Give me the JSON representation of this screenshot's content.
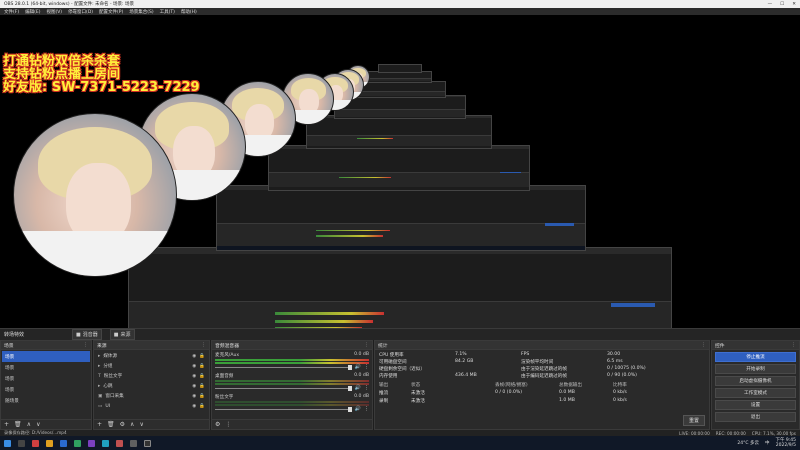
{
  "window": {
    "title": "OBS 28.0.1 (64-bit, windows) - 配置文件: 未命名 - 场景: 场景",
    "controls": [
      "—",
      "☐",
      "✕"
    ]
  },
  "menu": [
    "文件(F)",
    "编辑(E)",
    "视图(V)",
    "停靠窗口(D)",
    "配置文件(P)",
    "场景集合(S)",
    "工具(T)",
    "帮助(H)"
  ],
  "preview": {
    "overlay_lines": [
      "打通钻粉双倍杀杀套",
      "支持钻粉点播上房间",
      "好友版: SW-7371-5223-7229"
    ]
  },
  "dock_tabs": {
    "left_label": "转场特效",
    "tab1": "混音器",
    "tab2": "来源"
  },
  "scenes": {
    "title": "场景",
    "items": [
      "场景",
      "场景",
      "场景",
      "场景",
      "场景",
      "随场景"
    ],
    "selected_index": 0,
    "footer": [
      "+",
      "🗑",
      "∧",
      "∨"
    ]
  },
  "sources": {
    "title": "来源",
    "items": [
      {
        "icon": "▸",
        "name": "媒体源"
      },
      {
        "icon": "▸",
        "name": "分组"
      },
      {
        "icon": "T",
        "name": "粉丝文字"
      },
      {
        "icon": "▸",
        "name": "心跳"
      },
      {
        "icon": "▣",
        "name": "窗口采集"
      },
      {
        "icon": "▭",
        "name": "UI"
      }
    ],
    "footer": [
      "+",
      "🗑",
      "⚙",
      "∧",
      "∨"
    ]
  },
  "mixer": {
    "title": "音频混音器",
    "channels": [
      {
        "name": "麦克风/Aux",
        "db": "0.0 dB",
        "level": 0.72
      },
      {
        "name": "桌面音频",
        "db": "0.0 dB",
        "level": 0.6
      },
      {
        "name": "粉丝文字",
        "db": "0.0 dB",
        "level": 0.0
      }
    ],
    "footer": [
      "⚙",
      "⋮"
    ]
  },
  "stats": {
    "title": "统计",
    "left": [
      {
        "k": "CPU 使用率",
        "v": "7.1%"
      },
      {
        "k": "可用磁盘空间",
        "v": "84.2 GB"
      },
      {
        "k": "硬盘剩余空间（近似）",
        "v": ""
      },
      {
        "k": "内存使用",
        "v": "436.4 MB"
      }
    ],
    "right": [
      {
        "k": "FPS",
        "v": "30.00"
      },
      {
        "k": "渲染帧平均时间",
        "v": "6.5 ms"
      },
      {
        "k": "由于渲染延迟跳过的帧",
        "v": "0 / 10075 (0.0%)"
      },
      {
        "k": "由于编码延迟跳过的帧",
        "v": "0 / 90 (0.0%)"
      }
    ],
    "table_headers": [
      "输出",
      "状态",
      "丢帧(网络/拥塞)",
      "总数据输出",
      "比特率"
    ],
    "table_rows": [
      [
        "推流",
        "未激活",
        "0 / 0 (0.0%)",
        "0.0 MB",
        "0 kb/s"
      ],
      [
        "录制",
        "未激活",
        "",
        "1.0 MB",
        "0 kb/s"
      ]
    ],
    "reset": "重置"
  },
  "controls": {
    "title": "控件",
    "buttons": [
      "停止推流",
      "开始录制",
      "启动虚拟摄像机",
      "工作室模式",
      "设置",
      "退出"
    ]
  },
  "statusbar": {
    "left": "录像保存路径: D:/Videos/...mp4",
    "live": "LIVE: 00:00:00",
    "rec": "REC: 00:00:00",
    "cpu": "CPU: 7.1%, 30.00 fps"
  },
  "taskbar": {
    "weather": "24°C 多云",
    "lang": "中",
    "time": "下午 9:45",
    "date": "2022/9/5"
  }
}
